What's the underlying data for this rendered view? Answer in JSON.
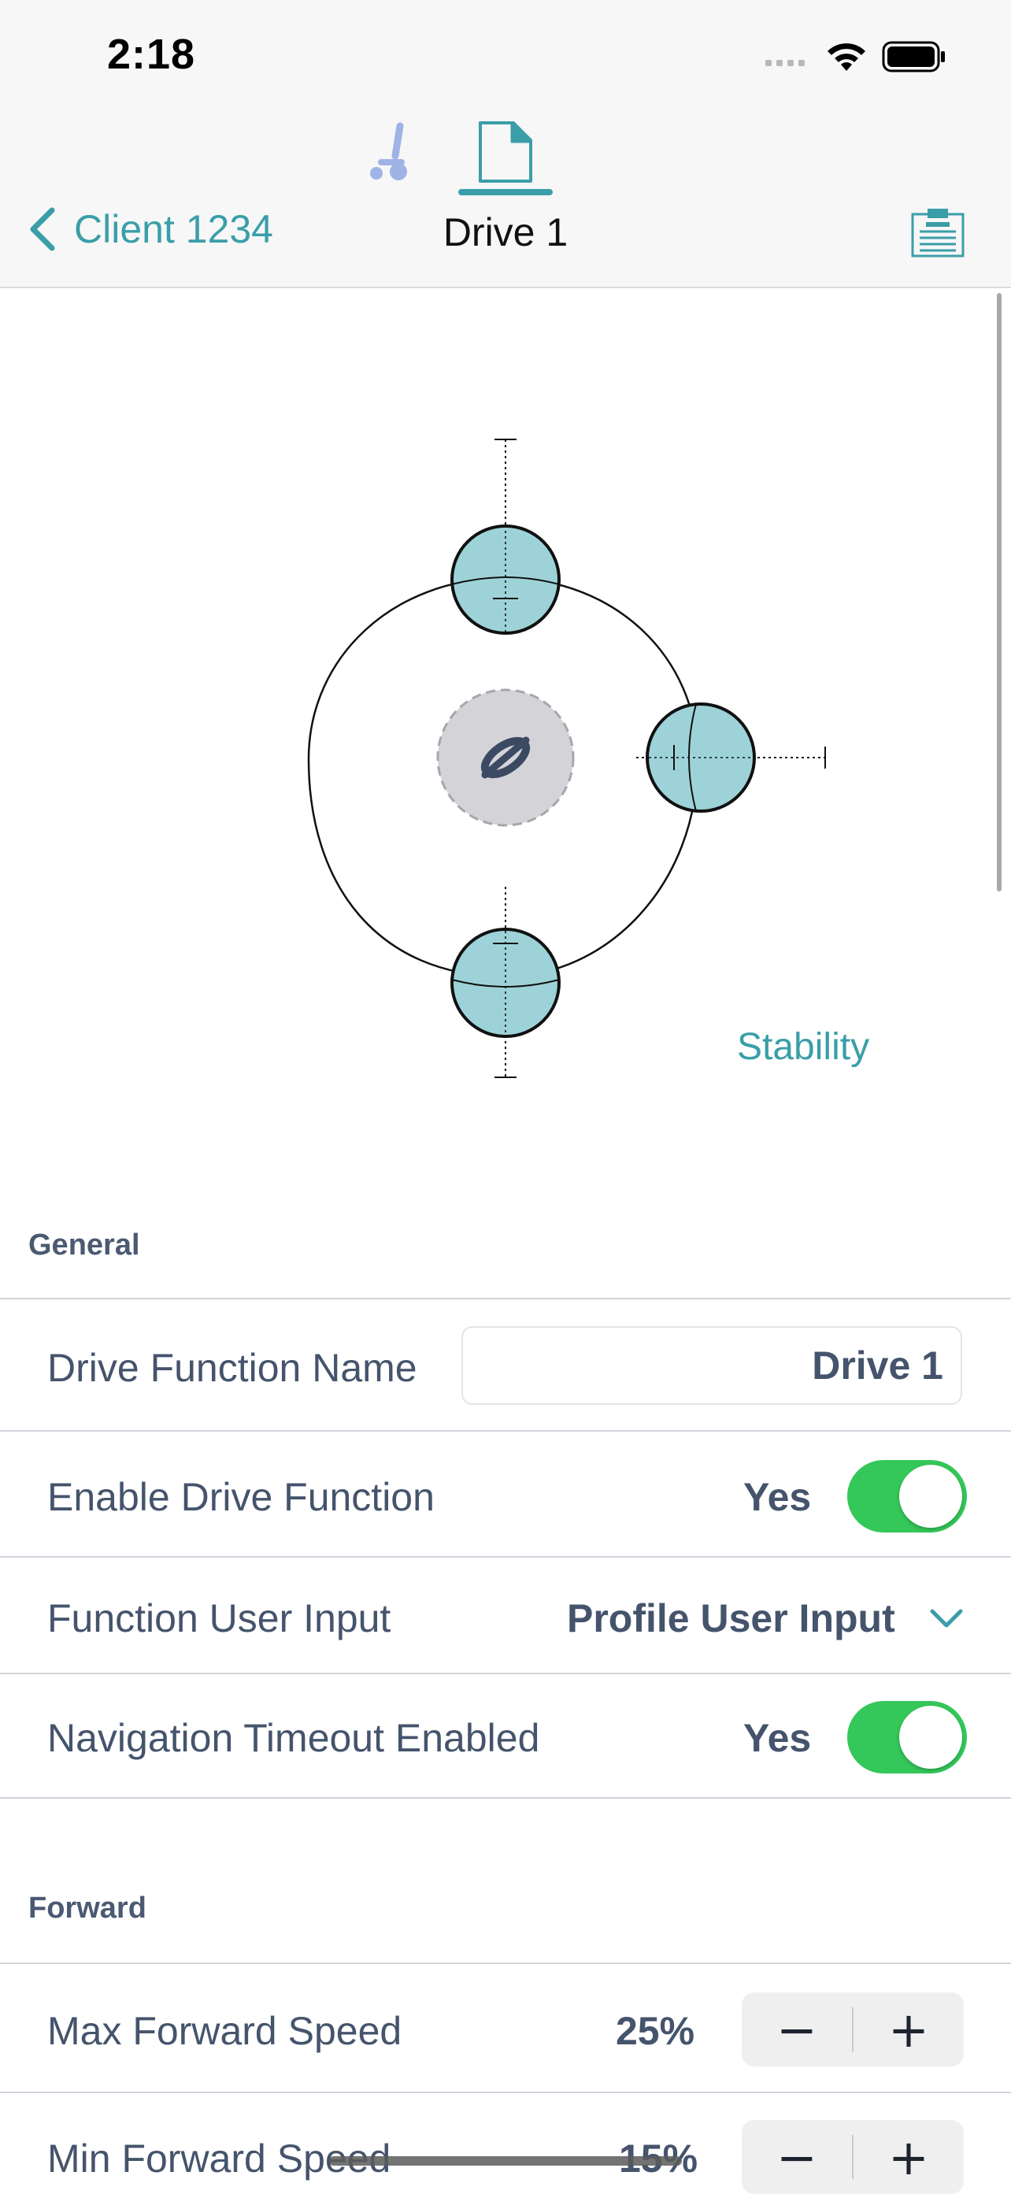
{
  "status_bar": {
    "time": "2:18"
  },
  "nav": {
    "back_label": "Client 1234",
    "title": "Drive 1",
    "tabs": [
      {
        "icon": "wheelchair-icon",
        "active": false
      },
      {
        "icon": "document-icon",
        "active": true
      }
    ],
    "right_icon": "clipboard-icon"
  },
  "diagram": {
    "stability_label": "Stability"
  },
  "general": {
    "title": "General",
    "drive_function_name": {
      "label": "Drive Function Name",
      "value": "Drive 1"
    },
    "enable_drive_function": {
      "label": "Enable Drive Function",
      "value": "Yes",
      "on": true
    },
    "function_user_input": {
      "label": "Function User Input",
      "value": "Profile User Input"
    },
    "navigation_timeout": {
      "label": "Navigation Timeout Enabled",
      "value": "Yes",
      "on": true
    }
  },
  "forward": {
    "title": "Forward",
    "max_forward_speed": {
      "label": "Max Forward Speed",
      "value": "25%"
    },
    "min_forward_speed": {
      "label": "Min Forward Speed",
      "value": "15%"
    }
  },
  "stepper": {
    "minus": "−",
    "plus": "+"
  },
  "colors": {
    "accent": "#3a9ea8",
    "toggle_on": "#34c759",
    "wheel_fill": "#9dd3d8"
  }
}
